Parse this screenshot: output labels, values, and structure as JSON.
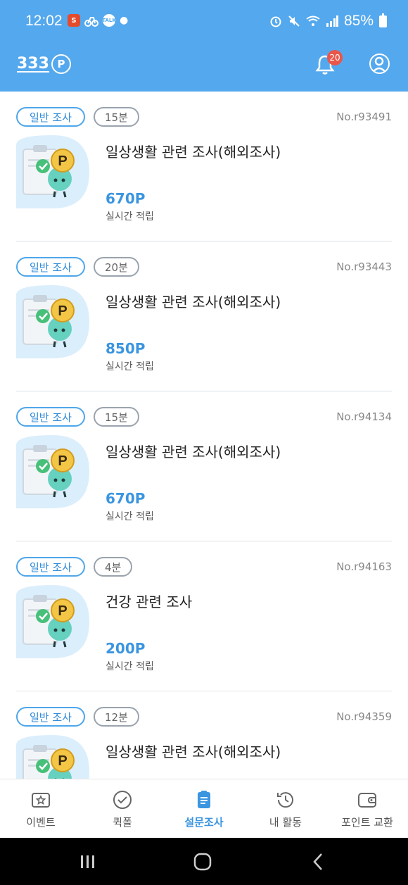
{
  "status_bar": {
    "time": "12:02",
    "battery": "85%",
    "app_icons": [
      "notification-app-icon",
      "bike-delivery-icon",
      "kakaotalk-talk-icon"
    ],
    "right_icons": [
      "alarm-icon",
      "mute-icon",
      "wifi-icon",
      "signal-icon",
      "battery-icon"
    ]
  },
  "header": {
    "points": "333",
    "points_symbol": "P",
    "notification_count": "20",
    "accent_color": "#54a8ed"
  },
  "surveys": [
    {
      "type": "일반 조사",
      "duration": "15분",
      "number": "No.r93491",
      "title": "일상생활 관련 조사(해외조사)",
      "points": "670P",
      "reward_note": "실시간 적립"
    },
    {
      "type": "일반 조사",
      "duration": "20분",
      "number": "No.r93443",
      "title": "일상생활 관련 조사(해외조사)",
      "points": "850P",
      "reward_note": "실시간 적립"
    },
    {
      "type": "일반 조사",
      "duration": "15분",
      "number": "No.r94134",
      "title": "일상생활 관련 조사(해외조사)",
      "points": "670P",
      "reward_note": "실시간 적립"
    },
    {
      "type": "일반 조사",
      "duration": "4분",
      "number": "No.r94163",
      "title": "건강 관련 조사",
      "points": "200P",
      "reward_note": "실시간 적립"
    },
    {
      "type": "일반 조사",
      "duration": "12분",
      "number": "No.r94359",
      "title": "일상생활 관련 조사(해외조사)",
      "points": "",
      "reward_note": ""
    }
  ],
  "bottom_nav": [
    {
      "label": "이벤트",
      "icon": "event-star-icon",
      "active": false
    },
    {
      "label": "퀵폴",
      "icon": "check-circle-icon",
      "active": false
    },
    {
      "label": "설문조사",
      "icon": "survey-clipboard-icon",
      "active": true
    },
    {
      "label": "내 활동",
      "icon": "history-icon",
      "active": false
    },
    {
      "label": "포인트 교환",
      "icon": "wallet-icon",
      "active": false
    }
  ],
  "system_nav": [
    "recent-apps-icon",
    "home-icon",
    "back-icon"
  ],
  "thumb_symbol": "P"
}
